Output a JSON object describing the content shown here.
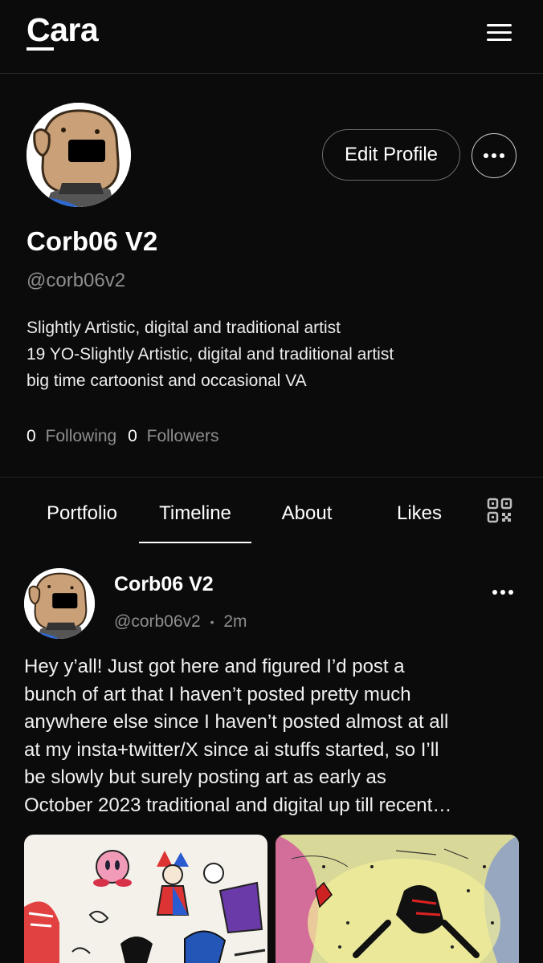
{
  "header": {
    "logo": "Cara",
    "menu_icon": "hamburger-menu-icon"
  },
  "profile": {
    "edit_label": "Edit Profile",
    "more_icon": "more-horizontal-icon",
    "name": "Corb06 V2",
    "handle": "@corb06v2",
    "bio_lines": [
      "Slightly Artistic, digital and traditional artist",
      "19 YO-Slightly Artistic, digital and traditional artist",
      "big time cartoonist and occasional VA"
    ],
    "following_count": "0",
    "following_label": "Following",
    "followers_count": "0",
    "followers_label": "Followers"
  },
  "tabs": [
    {
      "label": "Portfolio"
    },
    {
      "label": "Timeline",
      "active": true
    },
    {
      "label": "About"
    },
    {
      "label": "Likes"
    }
  ],
  "qr_icon": "qr-code-icon",
  "post": {
    "author": "Corb06 V2",
    "handle": "@corb06v2",
    "separator": "•",
    "time": "2m",
    "text_lines": [
      "Hey y’all! Just got here and figured I’d post a",
      "bunch of art that I haven’t posted pretty much",
      "anywhere else since I haven’t posted almost at all",
      "at my insta+twitter/X since ai stuffs started, so I’ll",
      "be slowly but surely posting art as early as",
      "October 2023 traditional and digital up till recent…"
    ]
  },
  "colors": {
    "background": "#0b0b0b",
    "divider": "#262626",
    "muted_text": "#8e8e8e"
  }
}
